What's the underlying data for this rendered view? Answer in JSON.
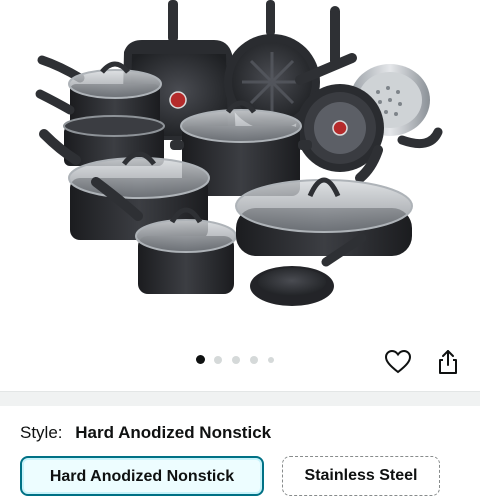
{
  "product": {
    "image_alt_icon": "cookware-set-icon",
    "carousel": {
      "total": 5,
      "active": 1
    }
  },
  "actions": {
    "favorite_icon": "heart-icon",
    "share_icon": "share-icon"
  },
  "style_selector": {
    "label": "Style:",
    "selected_value": "Hard Anodized Nonstick",
    "options": [
      {
        "label": "Hard Anodized Nonstick",
        "selected": true
      },
      {
        "label": "Stainless Steel",
        "selected": false
      }
    ]
  },
  "colors": {
    "selected_border": "#007185",
    "selected_bg": "#edfdff",
    "pan_body": "#2b2d31",
    "pan_handle": "#3a3c40"
  }
}
